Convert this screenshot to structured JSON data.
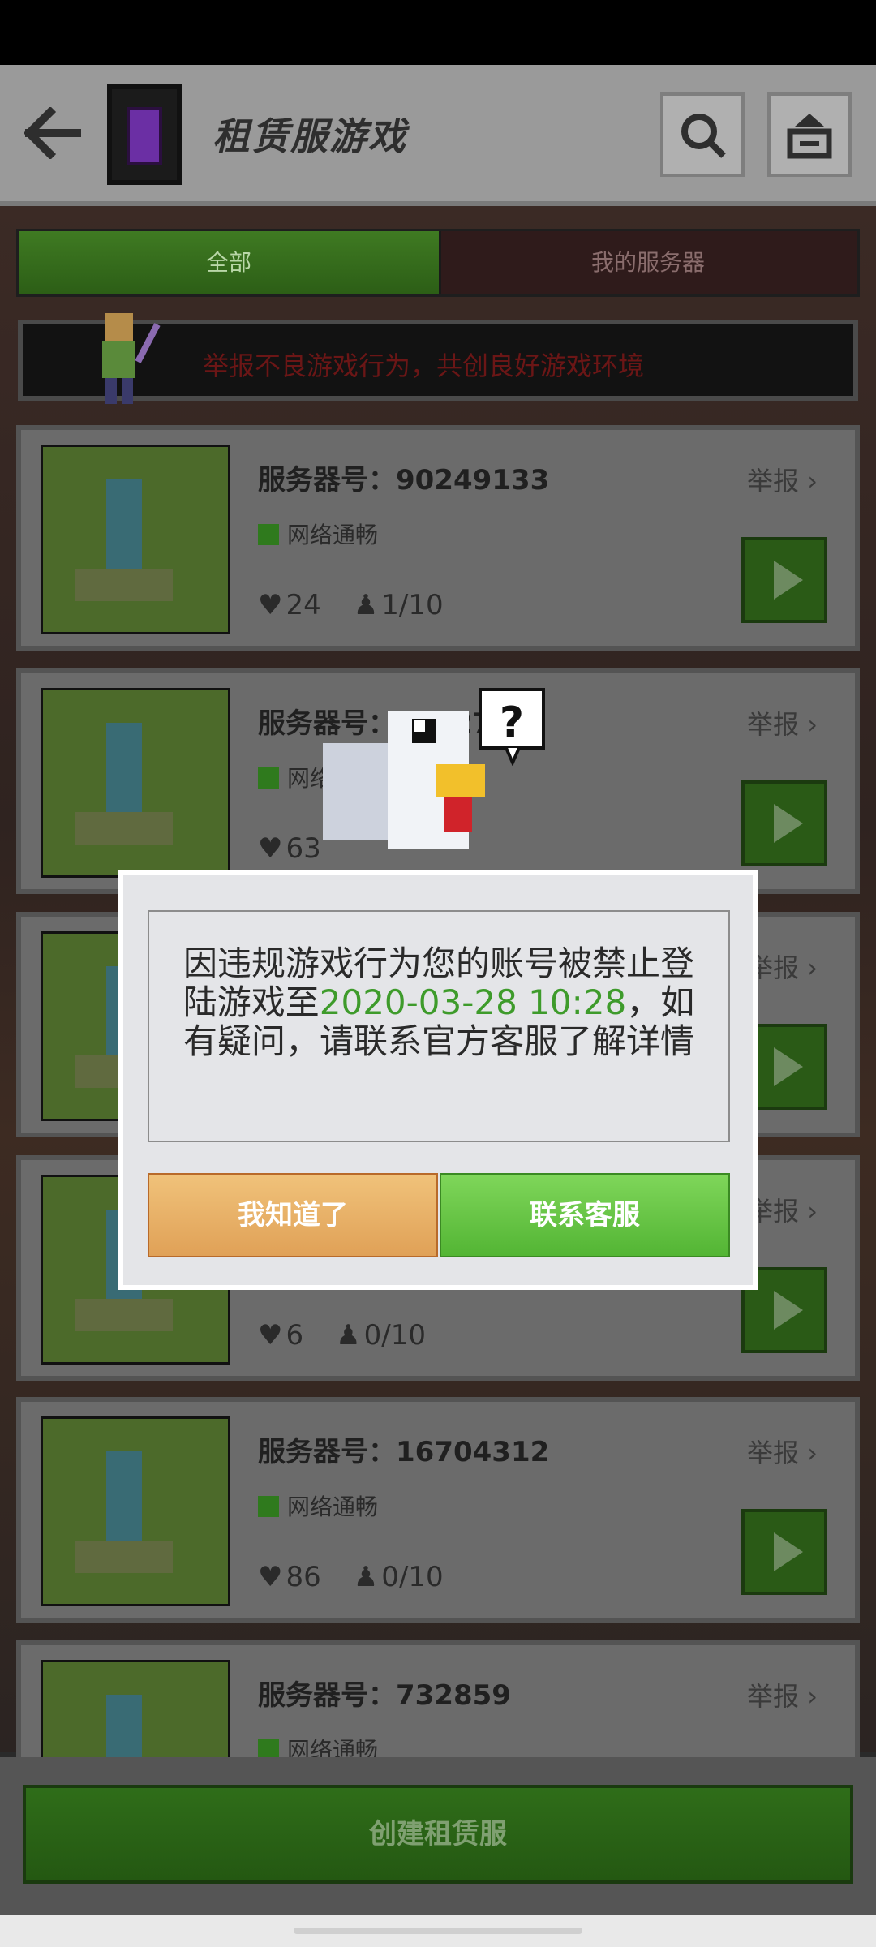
{
  "header": {
    "title": "租赁服游戏"
  },
  "tabs": {
    "all": "全部",
    "mine": "我的服务器"
  },
  "banner": {
    "text": "举报不良游戏行为，共创良好游戏环境"
  },
  "servers": [
    {
      "label": "服务器号：90249133",
      "network": "网络通畅",
      "likes": "24",
      "players": "1/10",
      "report": "举报"
    },
    {
      "label": "服务器号：25827",
      "network": "网络通畅",
      "likes": "63",
      "players": "",
      "report": "举报"
    },
    {
      "label": "",
      "network": "",
      "likes": "",
      "players": "",
      "report": "举报"
    },
    {
      "label": "",
      "network": "",
      "likes": "6",
      "players": "0/10",
      "report": "举报"
    },
    {
      "label": "服务器号：16704312",
      "network": "网络通畅",
      "likes": "86",
      "players": "0/10",
      "report": "举报"
    },
    {
      "label": "服务器号：732859",
      "network": "网络通畅",
      "likes": "",
      "players": "",
      "report": "举报"
    }
  ],
  "dialog": {
    "message_pre": "因违规游戏行为您的账号被禁止登陆游戏至",
    "message_date": "2020-03-28 10:28",
    "message_post": "，如有疑问，请联系官方客服了解详情",
    "ok_label": "我知道了",
    "contact_label": "联系客服"
  },
  "footer": {
    "create_label": "创建租赁服"
  },
  "colors": {
    "accent_green": "#3e9b2b",
    "button_orange": "#e0a157",
    "button_green": "#53b534"
  }
}
